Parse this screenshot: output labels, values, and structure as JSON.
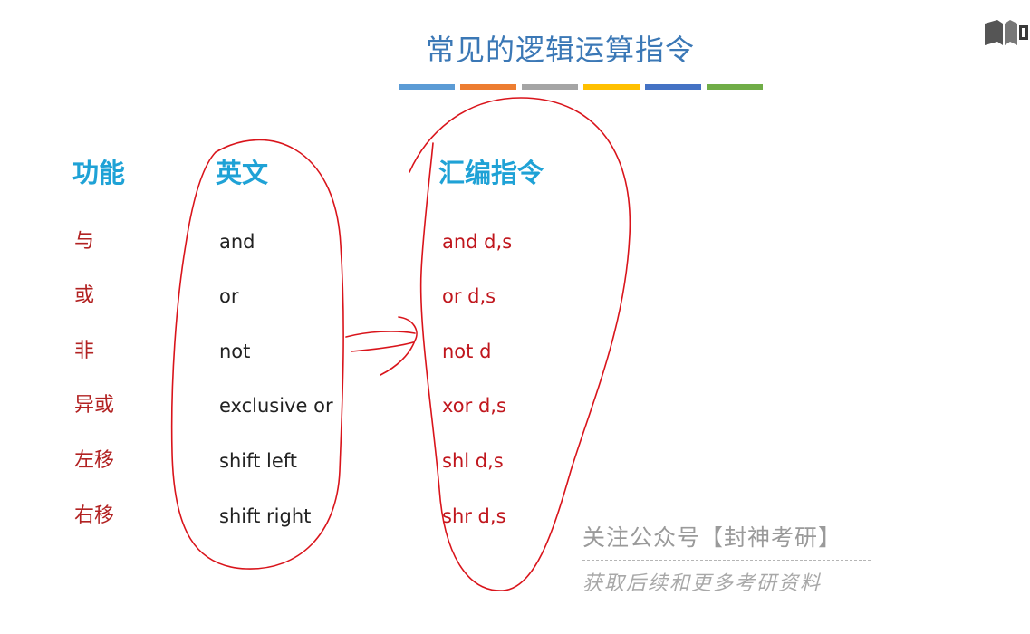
{
  "slide": {
    "title": "常见的逻辑运算指令",
    "color_bars": [
      "#5b9bd5",
      "#ed7d31",
      "#a5a5a5",
      "#ffc000",
      "#4472c4",
      "#70ad47"
    ],
    "logo_icon": "book-logo-icon"
  },
  "table": {
    "headers": {
      "function": "功能",
      "english": "英文",
      "assembly": "汇编指令"
    },
    "rows": [
      {
        "function": "与",
        "english": "and",
        "assembly": "and d,s"
      },
      {
        "function": "或",
        "english": "or",
        "assembly": "or d,s"
      },
      {
        "function": "非",
        "english": "not",
        "assembly": "not d"
      },
      {
        "function": "异或",
        "english": "exclusive or",
        "assembly": "xor d,s"
      },
      {
        "function": "左移",
        "english": "shift left",
        "assembly": "shl d,s"
      },
      {
        "function": "右移",
        "english": "shift right",
        "assembly": "shr d,s"
      }
    ]
  },
  "annotations": {
    "ink_color": "#d9141b"
  },
  "watermark": {
    "line1": "关注公众号【封神考研】",
    "line2": "获取后续和更多考研资料"
  }
}
